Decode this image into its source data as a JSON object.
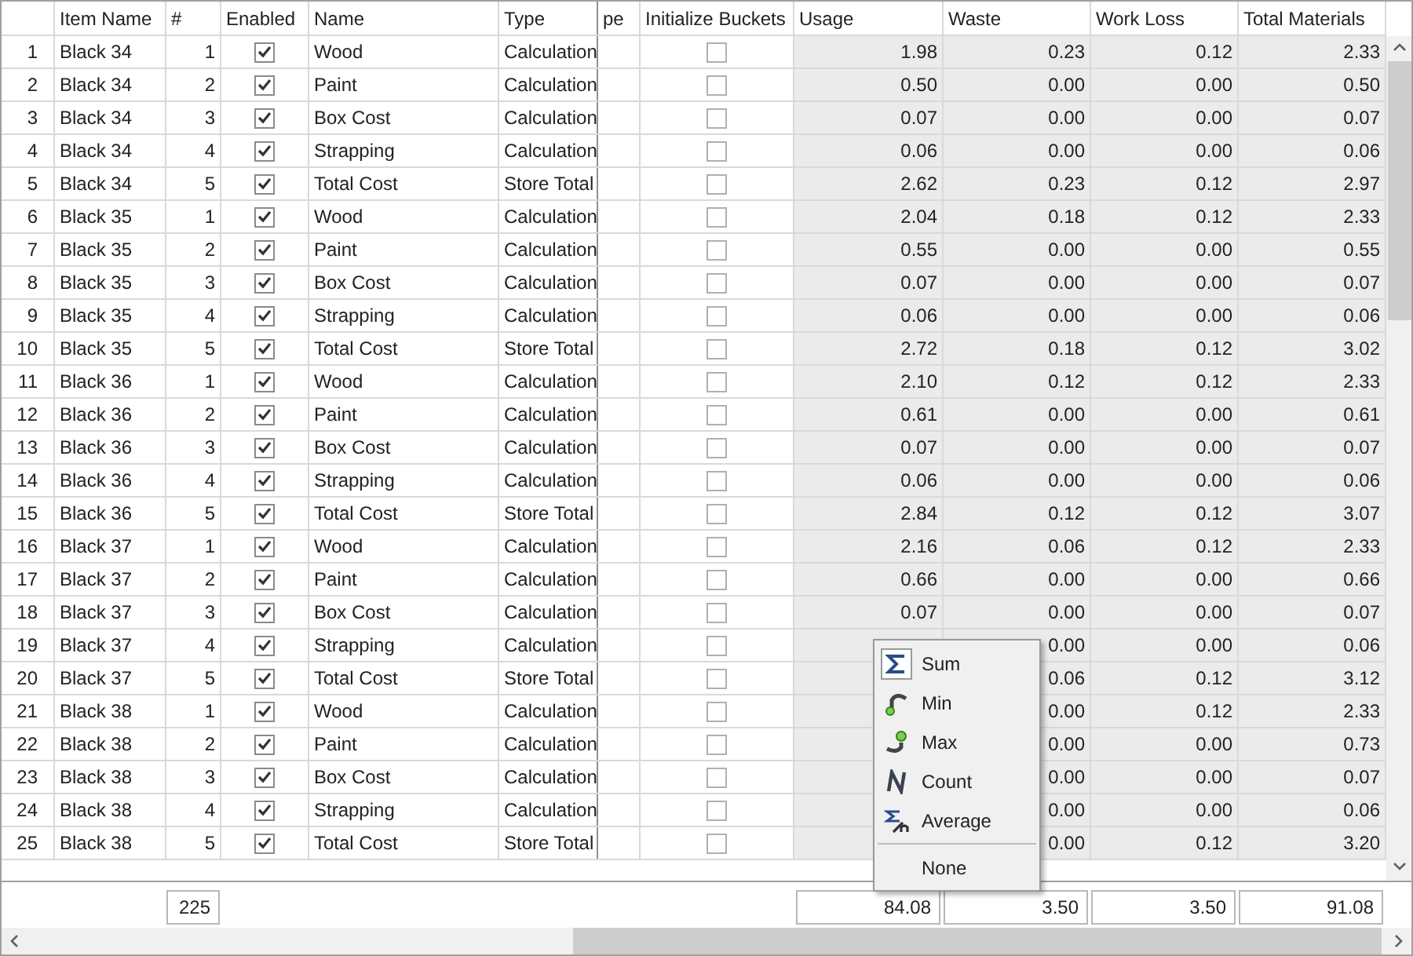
{
  "columns": [
    "Item Name",
    "#",
    "Enabled",
    "Name",
    "Type",
    "pe",
    "Initialize Buckets",
    "Usage",
    "Waste",
    "Work Loss",
    "Total Materials"
  ],
  "rows": [
    {
      "row": "1",
      "item": "Black 34",
      "num": "1",
      "enabled": true,
      "name": "Wood",
      "type": "Calculation",
      "initialize_buckets": false,
      "usage": "1.98",
      "waste": "0.23",
      "work_loss": "0.12",
      "total": "2.33"
    },
    {
      "row": "2",
      "item": "Black 34",
      "num": "2",
      "enabled": true,
      "name": "Paint",
      "type": "Calculation",
      "initialize_buckets": false,
      "usage": "0.50",
      "waste": "0.00",
      "work_loss": "0.00",
      "total": "0.50"
    },
    {
      "row": "3",
      "item": "Black 34",
      "num": "3",
      "enabled": true,
      "name": "Box Cost",
      "type": "Calculation",
      "initialize_buckets": false,
      "usage": "0.07",
      "waste": "0.00",
      "work_loss": "0.00",
      "total": "0.07"
    },
    {
      "row": "4",
      "item": "Black 34",
      "num": "4",
      "enabled": true,
      "name": "Strapping",
      "type": "Calculation",
      "initialize_buckets": false,
      "usage": "0.06",
      "waste": "0.00",
      "work_loss": "0.00",
      "total": "0.06"
    },
    {
      "row": "5",
      "item": "Black 34",
      "num": "5",
      "enabled": true,
      "name": "Total Cost",
      "type": "Store Total",
      "initialize_buckets": false,
      "usage": "2.62",
      "waste": "0.23",
      "work_loss": "0.12",
      "total": "2.97"
    },
    {
      "row": "6",
      "item": "Black 35",
      "num": "1",
      "enabled": true,
      "name": "Wood",
      "type": "Calculation",
      "initialize_buckets": false,
      "usage": "2.04",
      "waste": "0.18",
      "work_loss": "0.12",
      "total": "2.33"
    },
    {
      "row": "7",
      "item": "Black 35",
      "num": "2",
      "enabled": true,
      "name": "Paint",
      "type": "Calculation",
      "initialize_buckets": false,
      "usage": "0.55",
      "waste": "0.00",
      "work_loss": "0.00",
      "total": "0.55"
    },
    {
      "row": "8",
      "item": "Black 35",
      "num": "3",
      "enabled": true,
      "name": "Box Cost",
      "type": "Calculation",
      "initialize_buckets": false,
      "usage": "0.07",
      "waste": "0.00",
      "work_loss": "0.00",
      "total": "0.07"
    },
    {
      "row": "9",
      "item": "Black 35",
      "num": "4",
      "enabled": true,
      "name": "Strapping",
      "type": "Calculation",
      "initialize_buckets": false,
      "usage": "0.06",
      "waste": "0.00",
      "work_loss": "0.00",
      "total": "0.06"
    },
    {
      "row": "10",
      "item": "Black 35",
      "num": "5",
      "enabled": true,
      "name": "Total Cost",
      "type": "Store Total",
      "initialize_buckets": false,
      "usage": "2.72",
      "waste": "0.18",
      "work_loss": "0.12",
      "total": "3.02"
    },
    {
      "row": "11",
      "item": "Black 36",
      "num": "1",
      "enabled": true,
      "name": "Wood",
      "type": "Calculation",
      "initialize_buckets": false,
      "usage": "2.10",
      "waste": "0.12",
      "work_loss": "0.12",
      "total": "2.33"
    },
    {
      "row": "12",
      "item": "Black 36",
      "num": "2",
      "enabled": true,
      "name": "Paint",
      "type": "Calculation",
      "initialize_buckets": false,
      "usage": "0.61",
      "waste": "0.00",
      "work_loss": "0.00",
      "total": "0.61"
    },
    {
      "row": "13",
      "item": "Black 36",
      "num": "3",
      "enabled": true,
      "name": "Box Cost",
      "type": "Calculation",
      "initialize_buckets": false,
      "usage": "0.07",
      "waste": "0.00",
      "work_loss": "0.00",
      "total": "0.07"
    },
    {
      "row": "14",
      "item": "Black 36",
      "num": "4",
      "enabled": true,
      "name": "Strapping",
      "type": "Calculation",
      "initialize_buckets": false,
      "usage": "0.06",
      "waste": "0.00",
      "work_loss": "0.00",
      "total": "0.06"
    },
    {
      "row": "15",
      "item": "Black 36",
      "num": "5",
      "enabled": true,
      "name": "Total Cost",
      "type": "Store Total",
      "initialize_buckets": false,
      "usage": "2.84",
      "waste": "0.12",
      "work_loss": "0.12",
      "total": "3.07"
    },
    {
      "row": "16",
      "item": "Black 37",
      "num": "1",
      "enabled": true,
      "name": "Wood",
      "type": "Calculation",
      "initialize_buckets": false,
      "usage": "2.16",
      "waste": "0.06",
      "work_loss": "0.12",
      "total": "2.33"
    },
    {
      "row": "17",
      "item": "Black 37",
      "num": "2",
      "enabled": true,
      "name": "Paint",
      "type": "Calculation",
      "initialize_buckets": false,
      "usage": "0.66",
      "waste": "0.00",
      "work_loss": "0.00",
      "total": "0.66"
    },
    {
      "row": "18",
      "item": "Black 37",
      "num": "3",
      "enabled": true,
      "name": "Box Cost",
      "type": "Calculation",
      "initialize_buckets": false,
      "usage": "0.07",
      "waste": "0.00",
      "work_loss": "0.00",
      "total": "0.07"
    },
    {
      "row": "19",
      "item": "Black 37",
      "num": "4",
      "enabled": true,
      "name": "Strapping",
      "type": "Calculation",
      "initialize_buckets": false,
      "waste": "0.00",
      "work_loss": "0.00",
      "total": "0.06"
    },
    {
      "row": "20",
      "item": "Black 37",
      "num": "5",
      "enabled": true,
      "name": "Total Cost",
      "type": "Store Total",
      "initialize_buckets": false,
      "waste": "0.06",
      "work_loss": "0.12",
      "total": "3.12"
    },
    {
      "row": "21",
      "item": "Black 38",
      "num": "1",
      "enabled": true,
      "name": "Wood",
      "type": "Calculation",
      "initialize_buckets": false,
      "waste": "0.00",
      "work_loss": "0.12",
      "total": "2.33"
    },
    {
      "row": "22",
      "item": "Black 38",
      "num": "2",
      "enabled": true,
      "name": "Paint",
      "type": "Calculation",
      "initialize_buckets": false,
      "waste": "0.00",
      "work_loss": "0.00",
      "total": "0.73"
    },
    {
      "row": "23",
      "item": "Black 38",
      "num": "3",
      "enabled": true,
      "name": "Box Cost",
      "type": "Calculation",
      "initialize_buckets": false,
      "waste": "0.00",
      "work_loss": "0.00",
      "total": "0.07"
    },
    {
      "row": "24",
      "item": "Black 38",
      "num": "4",
      "enabled": true,
      "name": "Strapping",
      "type": "Calculation",
      "initialize_buckets": false,
      "waste": "0.00",
      "work_loss": "0.00",
      "total": "0.06"
    },
    {
      "row": "25",
      "item": "Black 38",
      "num": "5",
      "enabled": true,
      "name": "Total Cost",
      "type": "Store Total",
      "initialize_buckets": false,
      "waste": "0.00",
      "work_loss": "0.12",
      "total": "3.20"
    }
  ],
  "footer": {
    "num": "225",
    "usage": "84.08",
    "waste": "3.50",
    "work_loss": "3.50",
    "total": "91.08"
  },
  "context_menu": [
    {
      "label": "Sum",
      "selected": true
    },
    {
      "label": "Min",
      "selected": false
    },
    {
      "label": "Max",
      "selected": false
    },
    {
      "label": "Count",
      "selected": false
    },
    {
      "label": "Average",
      "selected": false
    },
    {
      "label": "None",
      "selected": false
    }
  ]
}
